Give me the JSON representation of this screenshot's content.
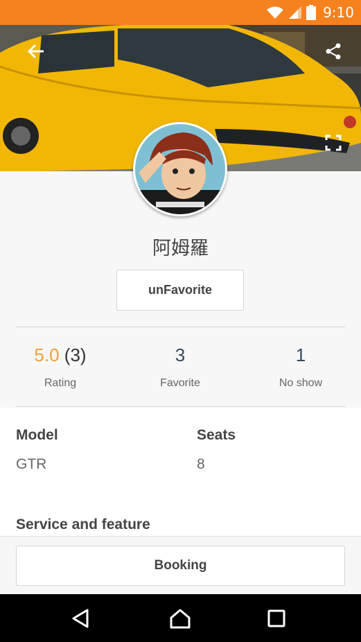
{
  "status_bar": {
    "time": "9:10",
    "icons": [
      "wifi-icon",
      "signal-icon",
      "battery-icon"
    ],
    "color": "#F5821F"
  },
  "hero": {
    "back_icon": "arrow-back-icon",
    "share_icon": "share-icon",
    "fullscreen_icon": "fullscreen-icon"
  },
  "profile": {
    "name": "阿姆羅",
    "favorite_button": "unFavorite",
    "stats": [
      {
        "value": "5.0",
        "value_extra": "(3)",
        "label": "Rating"
      },
      {
        "value": "3",
        "label": "Favorite"
      },
      {
        "value": "1",
        "label": "No show"
      }
    ]
  },
  "details": {
    "model_label": "Model",
    "model_value": "GTR",
    "seats_label": "Seats",
    "seats_value": "8",
    "service_label": "Service and feature"
  },
  "booking": {
    "label": "Booking"
  },
  "nav": {
    "icons": [
      "back-triangle-icon",
      "home-icon",
      "recents-icon"
    ]
  },
  "colors": {
    "accent_orange": "#F5821F",
    "rating_color": "#F0A030",
    "stat_blue": "#34495E"
  }
}
